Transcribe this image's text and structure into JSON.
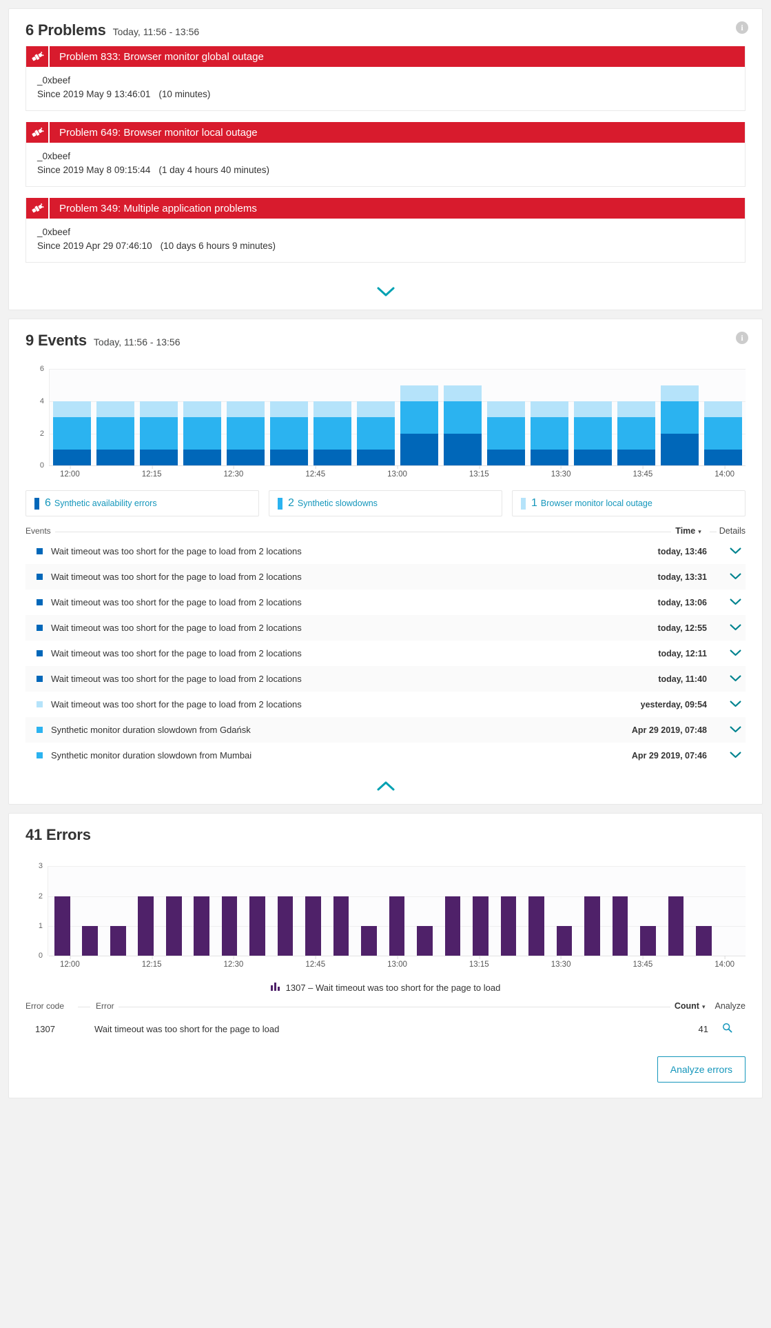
{
  "problems_card": {
    "title": "6 Problems",
    "subtitle": "Today, 11:56 - 13:56",
    "info_icon": "info-icon",
    "expand_icon": "chevron-down-icon",
    "items": [
      {
        "title": "Problem 833: Browser monitor global outage",
        "entity": "_0xbeef",
        "since": "Since 2019 May 9 13:46:01",
        "duration": "(10 minutes)",
        "icon": "plug-disconnected-icon",
        "color": "#d81b2d"
      },
      {
        "title": "Problem 649: Browser monitor local outage",
        "entity": "_0xbeef",
        "since": "Since 2019 May 8 09:15:44",
        "duration": "(1 day 4 hours 40 minutes)",
        "icon": "plug-disconnected-icon",
        "color": "#d81b2d"
      },
      {
        "title": "Problem 349: Multiple application problems",
        "entity": "_0xbeef",
        "since": "Since 2019 Apr 29 07:46:10",
        "duration": "(10 days 6 hours 9 minutes)",
        "icon": "plug-disconnected-icon",
        "color": "#d81b2d"
      }
    ]
  },
  "events_card": {
    "title": "9 Events",
    "subtitle": "Today, 11:56 - 13:56",
    "info_icon": "info-icon",
    "collapse_icon": "chevron-up-icon",
    "legend": [
      {
        "count": "6",
        "label": "Synthetic availability errors",
        "color": "#0067b9"
      },
      {
        "count": "2",
        "label": "Synthetic slowdowns",
        "color": "#2bb3f0"
      },
      {
        "count": "1",
        "label": "Browser monitor local outage",
        "color": "#b5e3fa"
      }
    ],
    "table": {
      "col_events": "Events",
      "col_time": "Time",
      "col_time_caret": "▾",
      "col_details": "Details",
      "rows": [
        {
          "swatch": "#0067b9",
          "title": "Wait timeout was too short for the page to load from 2 locations",
          "time": "today, 13:46",
          "chevron": "chevron-down-icon"
        },
        {
          "swatch": "#0067b9",
          "title": "Wait timeout was too short for the page to load from 2 locations",
          "time": "today, 13:31",
          "chevron": "chevron-down-icon"
        },
        {
          "swatch": "#0067b9",
          "title": "Wait timeout was too short for the page to load from 2 locations",
          "time": "today, 13:06",
          "chevron": "chevron-down-icon"
        },
        {
          "swatch": "#0067b9",
          "title": "Wait timeout was too short for the page to load from 2 locations",
          "time": "today, 12:55",
          "chevron": "chevron-down-icon"
        },
        {
          "swatch": "#0067b9",
          "title": "Wait timeout was too short for the page to load from 2 locations",
          "time": "today, 12:11",
          "chevron": "chevron-down-icon"
        },
        {
          "swatch": "#0067b9",
          "title": "Wait timeout was too short for the page to load from 2 locations",
          "time": "today, 11:40",
          "chevron": "chevron-down-icon"
        },
        {
          "swatch": "#b5e3fa",
          "title": "Wait timeout was too short for the page to load from 2 locations",
          "time": "yesterday, 09:54",
          "chevron": "chevron-down-icon"
        },
        {
          "swatch": "#2bb3f0",
          "title": "Synthetic monitor duration slowdown from Gdańsk",
          "time": "Apr 29 2019, 07:48",
          "chevron": "chevron-down-icon"
        },
        {
          "swatch": "#2bb3f0",
          "title": "Synthetic monitor duration slowdown from Mumbai",
          "time": "Apr 29 2019, 07:46",
          "chevron": "chevron-down-icon"
        }
      ]
    }
  },
  "errors_card": {
    "title": "41 Errors",
    "caption_icon": "bar-chart-icon",
    "caption": "1307 – Wait timeout was too short for the page to load",
    "table": {
      "col_error_code": "Error code",
      "col_error": "Error",
      "col_count": "Count",
      "col_count_caret": "▾",
      "col_analyze": "Analyze",
      "rows": [
        {
          "code": "1307",
          "message": "Wait timeout was too short for the page to load",
          "count": "41",
          "icon": "magnifier-icon"
        }
      ]
    },
    "analyze_button": "Analyze errors"
  },
  "chart_data": [
    {
      "type": "bar",
      "id": "events-stacked-bar",
      "stacked": true,
      "title": "",
      "xlabel": "",
      "ylabel": "",
      "ylim": [
        0,
        6
      ],
      "yticks": [
        0,
        2,
        4,
        6
      ],
      "grid": true,
      "legend_position": "below",
      "xtick_labels": [
        "12:00",
        "12:15",
        "12:30",
        "12:45",
        "13:00",
        "13:15",
        "13:30",
        "13:45",
        "14:00"
      ],
      "x": [
        "11:56",
        "12:01",
        "12:08",
        "12:15",
        "12:22",
        "12:29",
        "12:36",
        "12:43",
        "12:50",
        "12:57",
        "13:04",
        "13:11",
        "13:18",
        "13:25",
        "13:32",
        "13:39",
        "13:46",
        "13:53"
      ],
      "series": [
        {
          "name": "Synthetic availability errors",
          "color": "#0067b9",
          "values": [
            1,
            1,
            1,
            1,
            1,
            1,
            1,
            1,
            2,
            2,
            1,
            1,
            1,
            1,
            2,
            1
          ]
        },
        {
          "name": "Synthetic slowdowns",
          "color": "#2bb3f0",
          "values": [
            2,
            2,
            2,
            2,
            2,
            2,
            2,
            2,
            2,
            2,
            2,
            2,
            2,
            2,
            2,
            2
          ]
        },
        {
          "name": "Browser monitor local outage",
          "color": "#b5e3fa",
          "values": [
            1,
            1,
            1,
            1,
            1,
            1,
            1,
            1,
            1,
            1,
            1,
            1,
            1,
            1,
            1,
            1
          ]
        }
      ],
      "bar_totals": [
        4,
        4,
        4,
        4,
        4,
        4,
        4,
        4,
        5,
        5,
        4,
        4,
        4,
        4,
        5,
        4
      ]
    },
    {
      "type": "bar",
      "id": "errors-bar",
      "stacked": false,
      "title": "",
      "xlabel": "",
      "ylabel": "",
      "ylim": [
        0,
        3
      ],
      "yticks": [
        0,
        1,
        2,
        3
      ],
      "grid": true,
      "color": "#4f2169",
      "xtick_labels": [
        "12:00",
        "12:15",
        "12:30",
        "12:45",
        "13:00",
        "13:15",
        "13:30",
        "13:45",
        "14:00"
      ],
      "values": [
        2,
        1,
        1,
        2,
        2,
        2,
        2,
        2,
        2,
        2,
        2,
        1,
        2,
        1,
        2,
        2,
        2,
        2,
        1,
        2,
        2,
        1,
        2,
        1,
        0
      ]
    }
  ],
  "y_axis_events": [
    "6",
    "4",
    "2",
    "0"
  ],
  "y_axis_errors": [
    "3",
    "2",
    "1",
    "0"
  ],
  "x_axis_ticks": [
    "12:00",
    "12:15",
    "12:30",
    "12:45",
    "13:00",
    "13:15",
    "13:30",
    "13:45",
    "14:00"
  ],
  "colors": {
    "danger": "#d81b2d",
    "accent": "#1496bb",
    "chevron": "#00a1b2",
    "series_dark": "#0067b9",
    "series_mid": "#2bb3f0",
    "series_light": "#b5e3fa",
    "errors": "#4f2169"
  }
}
